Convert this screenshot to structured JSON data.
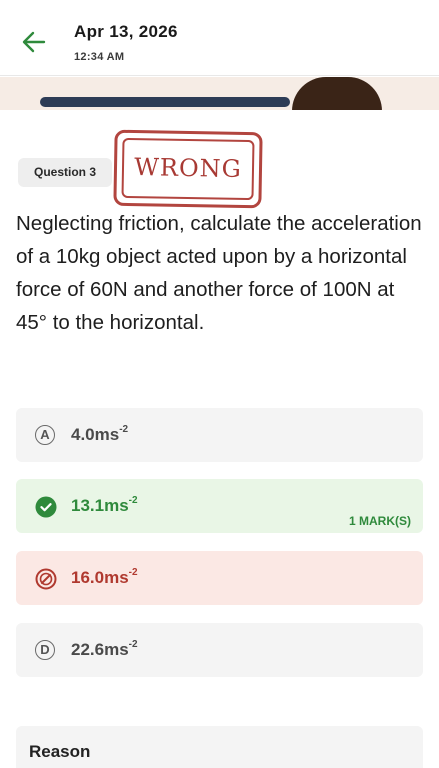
{
  "header": {
    "date": "Apr 13, 2026",
    "time": "12:34 AM"
  },
  "question": {
    "badge": "Question 3",
    "stamp": "WRONG",
    "text": "Neglecting friction, calculate the acceleration of a 10kg object acted upon by a horizontal force of 60N and another force of 100N at 45° to the horizontal."
  },
  "options": [
    {
      "letter": "A",
      "value": "4.0ms",
      "exp": "-2",
      "state": "neutral"
    },
    {
      "letter": "B",
      "value": "13.1ms",
      "exp": "-2",
      "state": "correct",
      "marks": "1 MARK(S)"
    },
    {
      "letter": "C",
      "value": "16.0ms",
      "exp": "-2",
      "state": "wrong"
    },
    {
      "letter": "D",
      "value": "22.6ms",
      "exp": "-2",
      "state": "neutral"
    }
  ],
  "reason": {
    "title": "Reason"
  },
  "colors": {
    "accent_green": "#2f8a3c",
    "correct_bg": "#e9f6e6",
    "wrong_red": "#b0392f",
    "wrong_bg": "#fbe8e4",
    "stamp_red": "#b2453f"
  },
  "icons": {
    "back": "arrow-left-icon",
    "correct": "check-circle-icon",
    "wrong": "x-circle-icon"
  }
}
